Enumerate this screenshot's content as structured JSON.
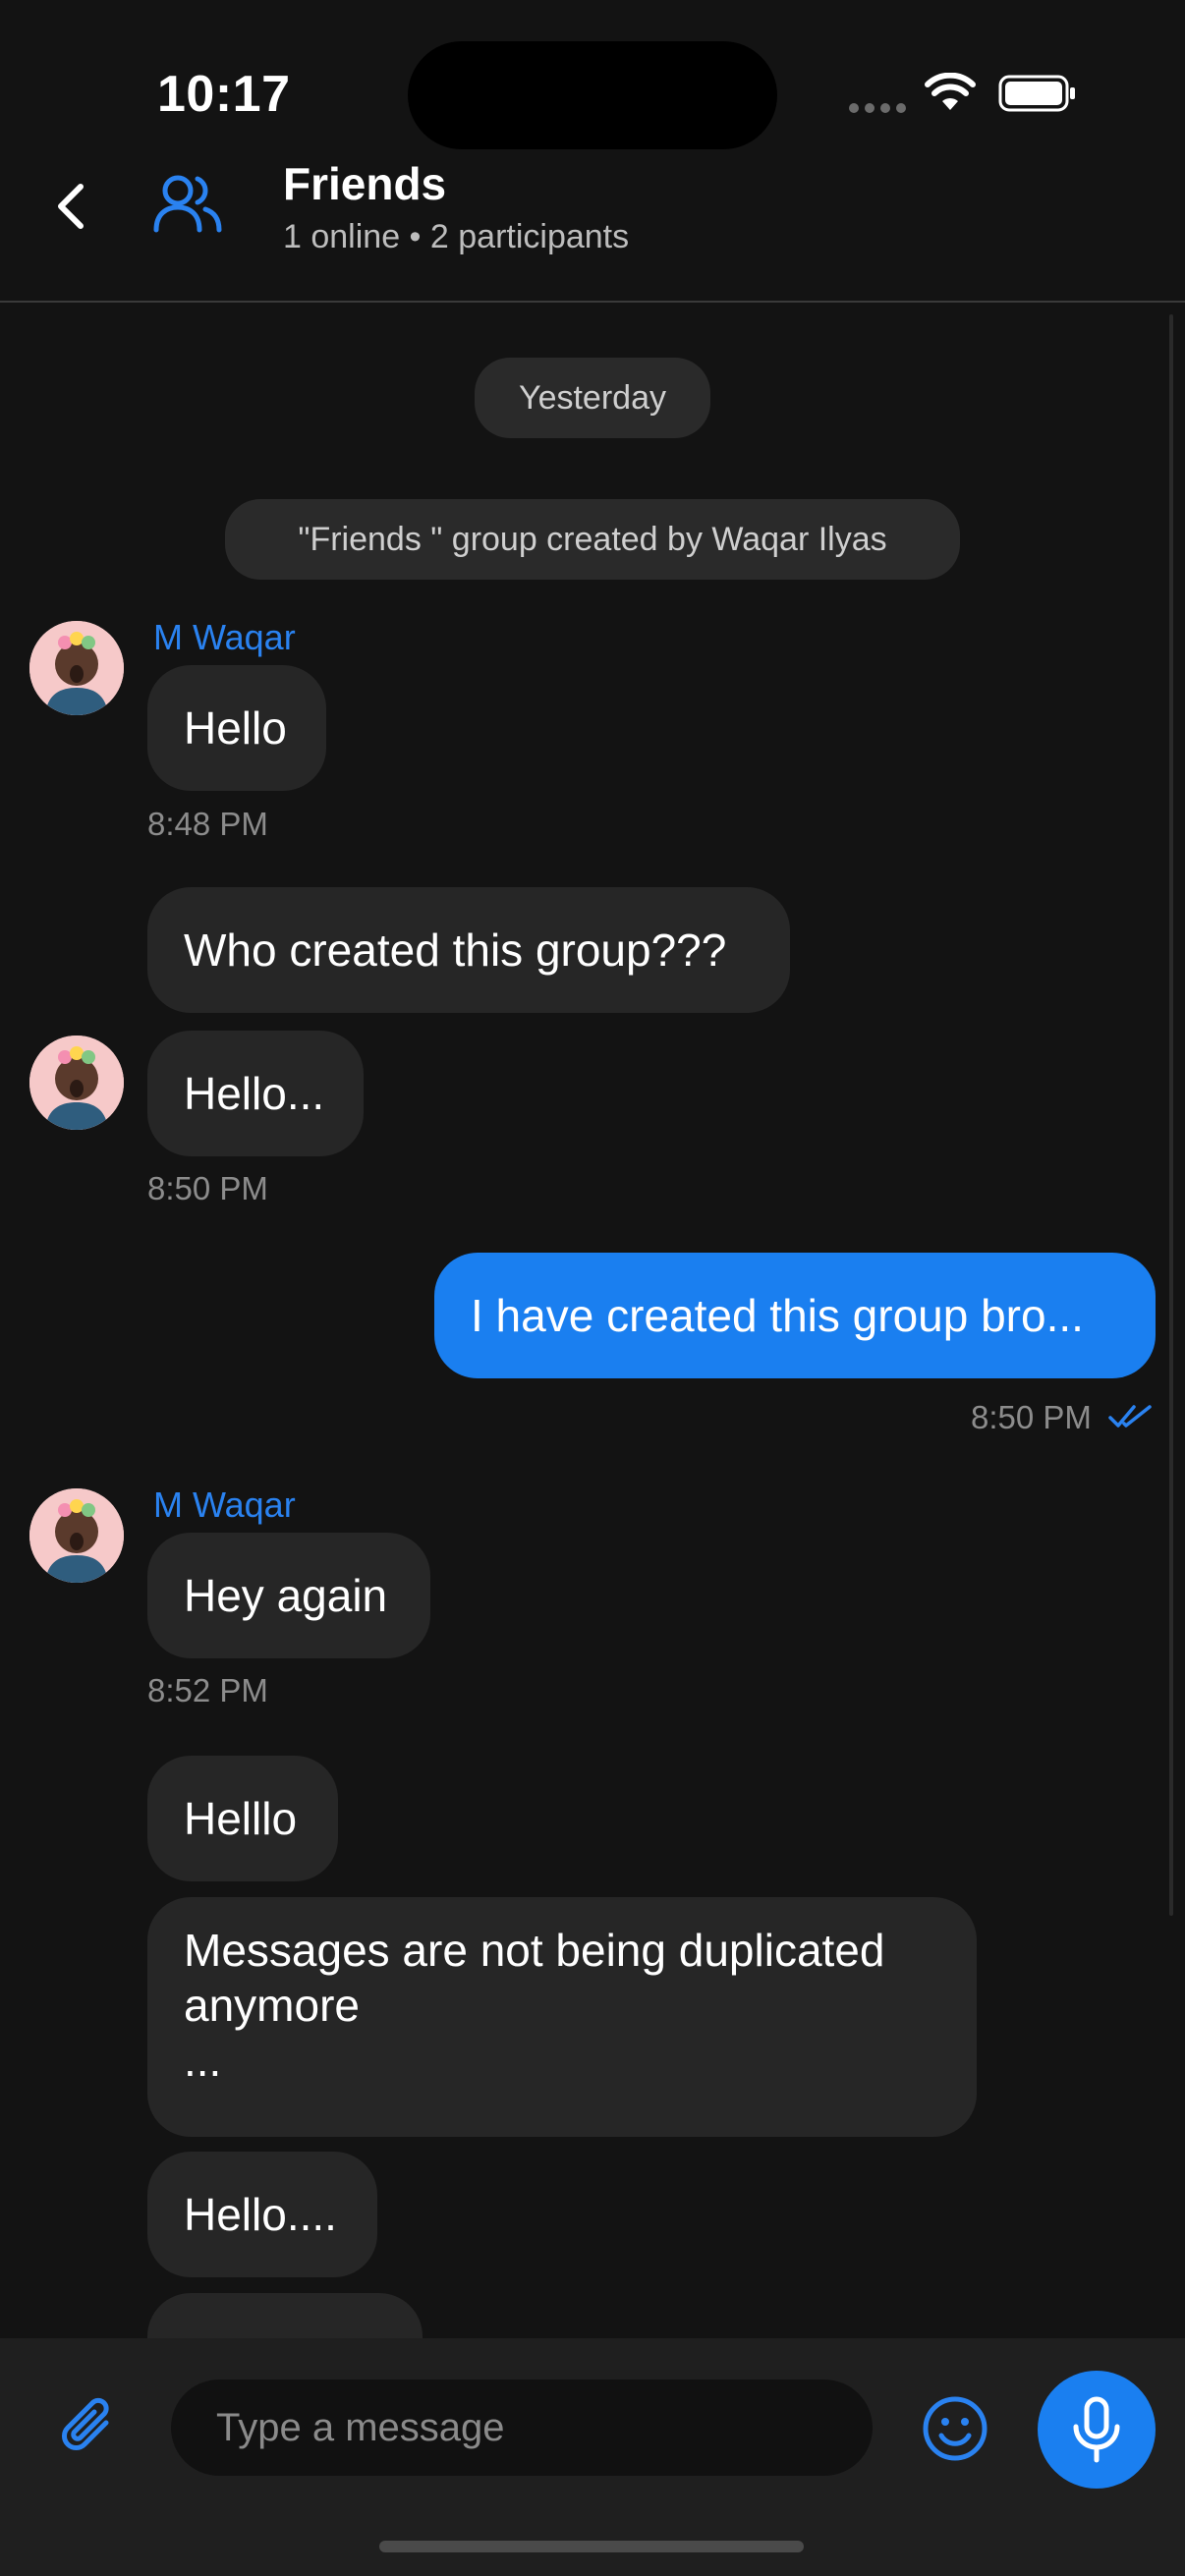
{
  "status_bar": {
    "time": "10:17"
  },
  "header": {
    "title": "Friends",
    "subtitle": "1 online • 2 participants"
  },
  "chat": {
    "date_separator": "Yesterday",
    "system_message": "\"Friends \" group created by Waqar Ilyas",
    "groups": [
      {
        "sender": "M Waqar",
        "messages": [
          "Hello"
        ],
        "time": "8:48 PM"
      },
      {
        "messages": [
          "Who created this group???",
          "Hello..."
        ],
        "time": "8:50 PM"
      },
      {
        "mine": true,
        "messages": [
          "I have created this group bro..."
        ],
        "time": "8:50 PM",
        "status": "read"
      },
      {
        "sender": "M Waqar",
        "messages": [
          "Hey again"
        ],
        "time": "8:52 PM"
      },
      {
        "messages": [
          "Helllo",
          "Messages are not being duplicated\nanymore\n...",
          "Hello...."
        ]
      }
    ]
  },
  "composer": {
    "placeholder": "Type a message"
  },
  "icons": {
    "back": "chevron-left-icon",
    "group": "users-icon",
    "attach": "paperclip-icon",
    "emoji": "smiley-icon",
    "mic": "microphone-icon",
    "read_receipt": "double-check-icon"
  },
  "colors": {
    "accent": "#1a7ff0",
    "background": "#131313",
    "bubble_incoming": "#262626"
  }
}
